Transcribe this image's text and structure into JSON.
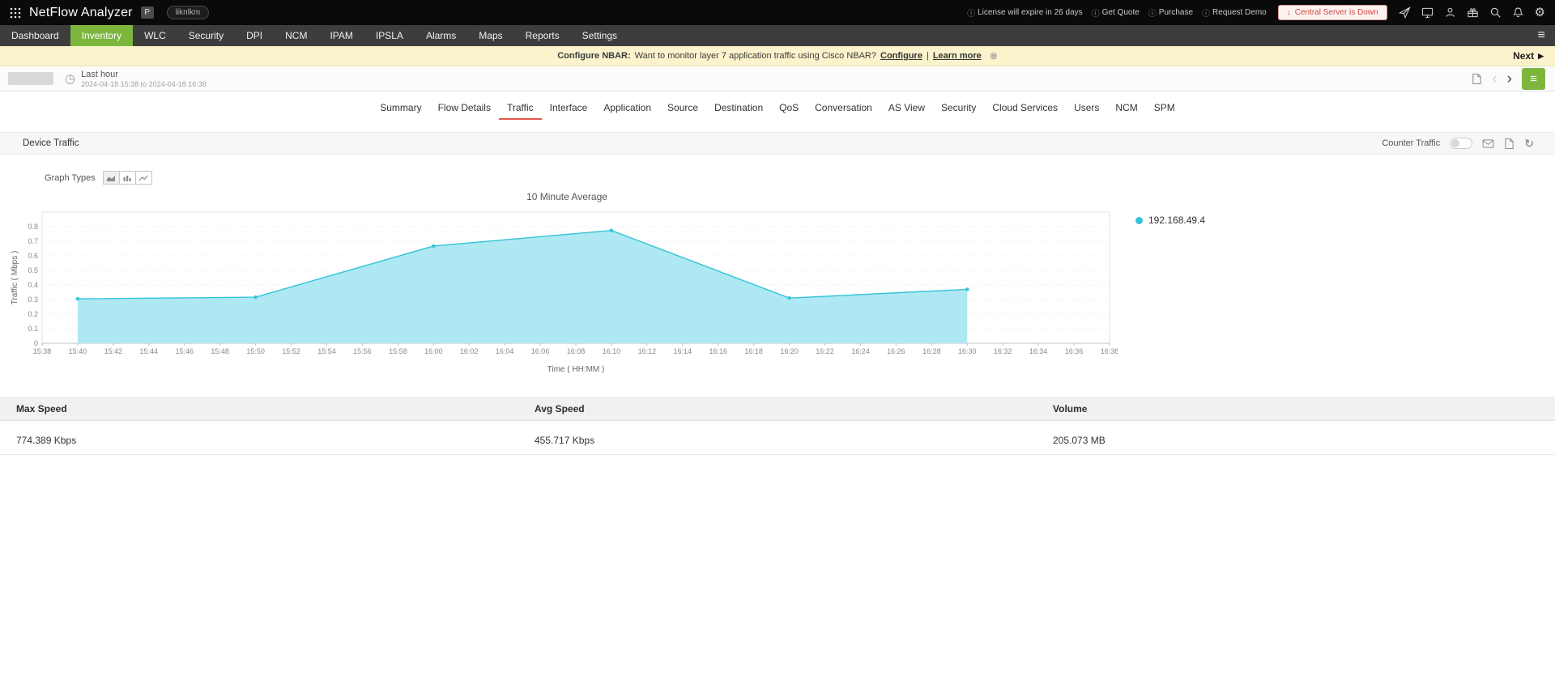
{
  "topbar": {
    "title": "NetFlow Analyzer",
    "badge": "P",
    "user_tag": "liknlkm",
    "status_items": [
      "License will expire in 26 days",
      "Get Quote",
      "Purchase",
      "Request Demo"
    ],
    "central_server": "Central Server is Down"
  },
  "nav": {
    "items": [
      {
        "label": "Dashboard"
      },
      {
        "label": "Inventory",
        "active": true
      },
      {
        "label": "WLC"
      },
      {
        "label": "Security"
      },
      {
        "label": "DPI"
      },
      {
        "label": "NCM"
      },
      {
        "label": "IPAM"
      },
      {
        "label": "IPSLA"
      },
      {
        "label": "Alarms"
      },
      {
        "label": "Maps"
      },
      {
        "label": "Reports"
      },
      {
        "label": "Settings"
      }
    ]
  },
  "banner": {
    "bold": "Configure NBAR:",
    "text": "Want to monitor layer 7 application traffic using Cisco NBAR?",
    "link1": "Configure",
    "sep": "|",
    "link2": "Learn more",
    "next": "Next"
  },
  "toolbar": {
    "time_range": "Last hour",
    "time_detail": "2024-04-18 15:38 to 2024-04-18 16:38"
  },
  "tabs": {
    "items": [
      {
        "label": "Summary"
      },
      {
        "label": "Flow Details"
      },
      {
        "label": "Traffic",
        "active": true
      },
      {
        "label": "Interface"
      },
      {
        "label": "Application"
      },
      {
        "label": "Source"
      },
      {
        "label": "Destination"
      },
      {
        "label": "QoS"
      },
      {
        "label": "Conversation"
      },
      {
        "label": "AS View"
      },
      {
        "label": "Security"
      },
      {
        "label": "Cloud Services"
      },
      {
        "label": "Users"
      },
      {
        "label": "NCM"
      },
      {
        "label": "SPM"
      }
    ]
  },
  "section": {
    "title": "Device Traffic",
    "counter_traffic_label": "Counter Traffic",
    "counter_traffic_on": false
  },
  "graph_types_label": "Graph Types",
  "chart_data": {
    "type": "area",
    "title": "10 Minute Average",
    "xlabel": "Time ( HH:MM )",
    "ylabel": "Traffic ( Mbps )",
    "ylim": [
      0,
      0.9
    ],
    "yticks": [
      0,
      0.1,
      0.2,
      0.3,
      0.4,
      0.5,
      0.6,
      0.7,
      0.8
    ],
    "xticks": [
      "15:38",
      "15:40",
      "15:42",
      "15:44",
      "15:46",
      "15:48",
      "15:50",
      "15:52",
      "15:54",
      "15:56",
      "15:58",
      "16:00",
      "16:02",
      "16:04",
      "16:06",
      "16:08",
      "16:10",
      "16:12",
      "16:14",
      "16:16",
      "16:18",
      "16:20",
      "16:22",
      "16:24",
      "16:26",
      "16:28",
      "16:30",
      "16:32",
      "16:34",
      "16:36",
      "16:38"
    ],
    "grid": "horizontal-dotted",
    "legend_position": "right",
    "series": [
      {
        "name": "192.168.49.4",
        "line_color": "#35c3d7",
        "fill_color": "#aee8f3",
        "points": [
          {
            "t": "15:40",
            "v": 0.305
          },
          {
            "t": "15:50",
            "v": 0.316
          },
          {
            "t": "16:00",
            "v": 0.667
          },
          {
            "t": "16:10",
            "v": 0.774
          },
          {
            "t": "16:20",
            "v": 0.31
          },
          {
            "t": "16:30",
            "v": 0.37
          }
        ]
      }
    ]
  },
  "table": {
    "headers": [
      "Max Speed",
      "Avg Speed",
      "Volume"
    ],
    "rows": [
      [
        "774.389 Kbps",
        "455.717 Kbps",
        "205.073 MB"
      ]
    ]
  },
  "icons": {
    "info": "ⓘ",
    "close": "⊗",
    "next_arrow": "▶",
    "down_arrow": "↓",
    "gear": "⚙",
    "refresh": "↻",
    "clock": "◷",
    "chevron_left": "‹",
    "chevron_right": "›",
    "hamburger": "≡"
  },
  "colors": {
    "accent_green": "#7cb63d",
    "alert_red": "#cf4a41",
    "banner_bg": "#faf3cc",
    "tab_underline": "#e4584c",
    "series_line": "#35c3d7",
    "series_fill": "#aee8f3"
  }
}
